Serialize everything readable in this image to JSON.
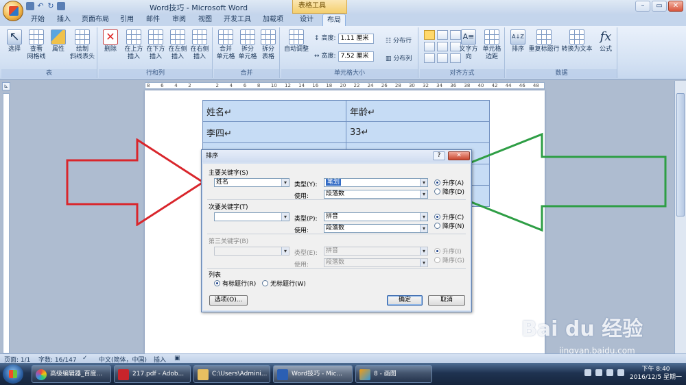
{
  "window": {
    "title": "Word技巧 - Microsoft Word",
    "context_tab": "表格工具"
  },
  "tabs": [
    "开始",
    "插入",
    "页面布局",
    "引用",
    "邮件",
    "审阅",
    "视图",
    "开发工具",
    "加载项",
    "设计",
    "布局"
  ],
  "ribbon": {
    "groups": {
      "table": {
        "label": "表",
        "buttons": [
          "选择",
          "查看\n网格线",
          "属性",
          "绘制\n斜线表头"
        ]
      },
      "rows_cols": {
        "label": "行和列",
        "buttons": [
          "删除",
          "在上方\n插入",
          "在下方\n插入",
          "在左侧\n插入",
          "在右侧\n插入"
        ]
      },
      "merge": {
        "label": "合并",
        "buttons": [
          "合并\n单元格",
          "拆分\n单元格",
          "拆分\n表格"
        ]
      },
      "cell_size": {
        "label": "单元格大小",
        "autofit": "自动调整",
        "height_label": "高度:",
        "height_value": "1.11 厘米",
        "width_label": "宽度:",
        "width_value": "7.52 厘米",
        "dist_rows": "分布行",
        "dist_cols": "分布列"
      },
      "alignment": {
        "label": "对齐方式",
        "buttons": [
          "文字方向",
          "单元格\n边距"
        ]
      },
      "data": {
        "label": "数据",
        "buttons": [
          "排序",
          "重复标题行",
          "转换为文本",
          "公式"
        ]
      }
    }
  },
  "ruler_ticks": [
    "8",
    "6",
    "4",
    "2",
    "",
    "2",
    "4",
    "6",
    "8",
    "10",
    "12",
    "14",
    "16",
    "18",
    "20",
    "22",
    "24",
    "26",
    "28",
    "30",
    "32",
    "34",
    "36",
    "38",
    "40",
    "42",
    "44",
    "46",
    "48"
  ],
  "document": {
    "rows": [
      [
        "姓名↵",
        "年龄↵"
      ],
      [
        "李四↵",
        "33↵"
      ],
      [
        "",
        ""
      ],
      [
        "",
        ""
      ],
      [
        "",
        ""
      ]
    ]
  },
  "dialog": {
    "title": "排序",
    "help": "?",
    "close": "✕",
    "primary": {
      "heading": "主要关键字(S)",
      "key": "姓名",
      "type_label": "类型(Y):",
      "type_value": "笔划",
      "use_label": "使用:",
      "use_value": "段落数",
      "asc": "升序(A)",
      "desc": "降序(D)"
    },
    "secondary": {
      "heading": "次要关键字(T)",
      "key": "",
      "type_label": "类型(P):",
      "type_value": "拼音",
      "use_label": "使用:",
      "use_value": "段落数",
      "asc": "升序(C)",
      "desc": "降序(N)"
    },
    "tertiary": {
      "heading": "第三关键字(B)",
      "key": "",
      "type_label": "类型(E):",
      "type_value": "拼音",
      "use_label": "使用:",
      "use_value": "段落数",
      "asc": "升序(I)",
      "desc": "降序(G)"
    },
    "list": {
      "heading": "列表",
      "has_header": "有标题行(R)",
      "no_header": "无标题行(W)"
    },
    "options_button": "选项(O)...",
    "ok_button": "确定",
    "cancel_button": "取消"
  },
  "status": {
    "page": "页面: 1/1",
    "words": "字数: 16/147",
    "language": "中文(简体，中国)",
    "mode": "插入"
  },
  "taskbar": {
    "items": [
      "高级编辑器_百度...",
      "217.pdf - Adob...",
      "C:\\Users\\Admini...",
      "Word技巧 - Mic...",
      "8 - 画图"
    ],
    "time": "下午 8:40",
    "date": "2016/12/5 星期一"
  },
  "watermark": {
    "brand": "Bai du 经验",
    "url": "jingyan.baidu.com"
  },
  "colors": {
    "red_arrow": "#d9262c",
    "green_arrow": "#2e9e45",
    "ribbon": "#d3e1f3",
    "table_fill": "#c6dcf5"
  }
}
